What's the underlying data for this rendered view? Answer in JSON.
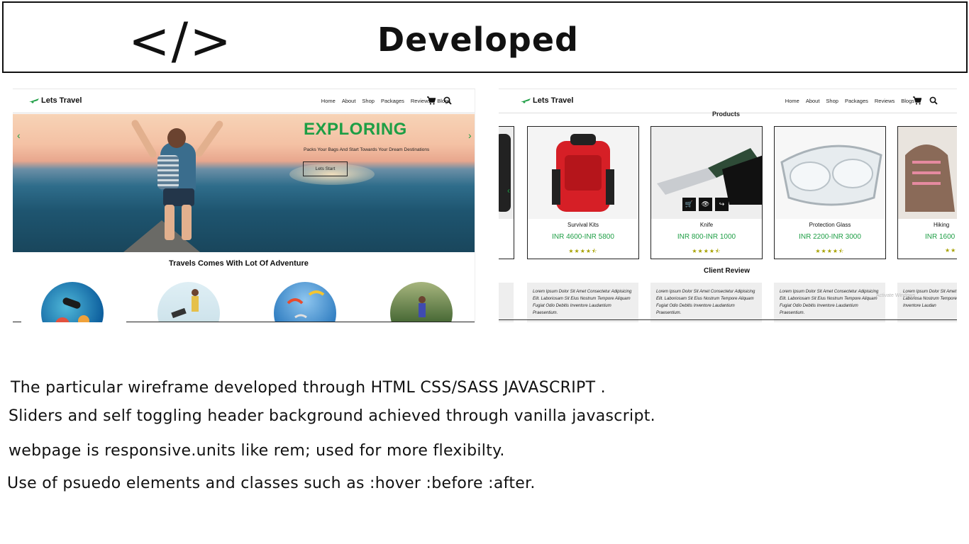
{
  "banner": {
    "code_symbol": "</>",
    "title": "Developed"
  },
  "left_site": {
    "logo": "Lets Travel",
    "nav": [
      "Home",
      "About",
      "Shop",
      "Packages",
      "Reviews",
      "Blogs"
    ],
    "hero": {
      "title": "EXPLORING",
      "subtitle": "Packs Your Bags And Start Towards Your Dream Destinations",
      "button": "Lets Start"
    },
    "section_title": "Travels Comes With Lot Of Adventure"
  },
  "right_site": {
    "logo": "Lets Travel",
    "nav": [
      "Home",
      "About",
      "Shop",
      "Packages",
      "Reviews",
      "Blogs"
    ],
    "products_title": "Products",
    "products": [
      {
        "name": "Survival Kits",
        "price": "INR 4600-INR 5800",
        "stars": "★★★★⯪"
      },
      {
        "name": "Knife",
        "price": "INR 800-INR 1000",
        "stars": "★★★★⯪"
      },
      {
        "name": "Protection Glass",
        "price": "INR 2200-INR 3000",
        "stars": "★★★★⯪"
      },
      {
        "name": "Hiking",
        "price": "INR 1600",
        "stars": "★★"
      }
    ],
    "review_title": "Client Review",
    "review_text": "Lorem Ipsum Dolor Sit Amet Consectetur Adipisicing Elit. Laboriosam Sit Eius Nostrum Tempore Aliquam Fugiat Odio Debitis Inventore Laudantium Praesentium.",
    "review_text_partial": "Lorem Ipsum Dolor Sit Amet Adipisicing Elit. Laboriosa Nostrum Tempore Aliquam Debitis Inventore Laudan",
    "watermark": "Activate Windows"
  },
  "description": [
    "The particular wireframe developed through HTML CSS/SASS  JAVASCRIPT .",
    "Sliders and self toggling header background achieved through vanilla javascript.",
    "webpage is responsive.units like rem; used for more flexibilty.",
    "Use of psuedo elements and classes such as :hover :before :after."
  ],
  "colors": {
    "accent_green": "#1e9e45",
    "star_color": "#a7a100",
    "text": "#111111"
  }
}
